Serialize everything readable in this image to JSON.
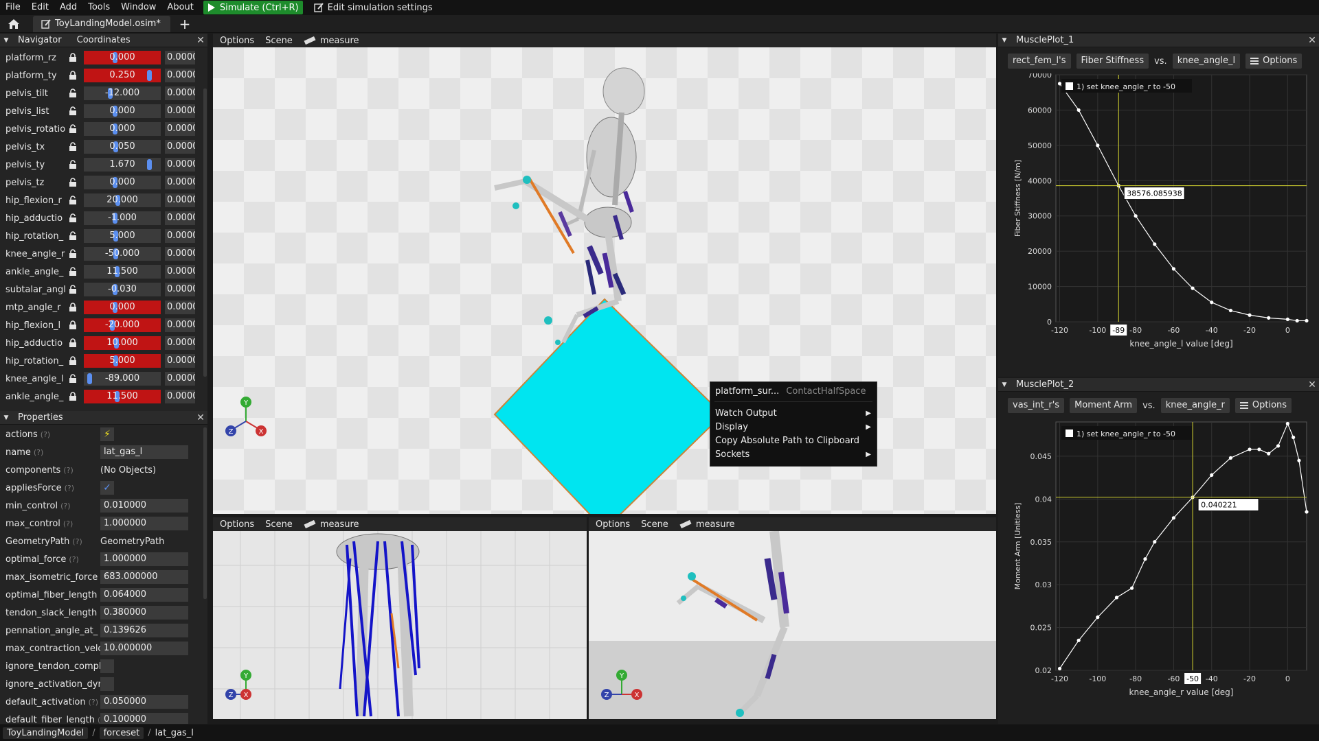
{
  "menu": {
    "items": [
      "File",
      "Edit",
      "Add",
      "Tools",
      "Window",
      "About"
    ],
    "simulate_label": "Simulate (Ctrl+R)",
    "edit_settings_label": "Edit simulation settings"
  },
  "tabs": {
    "document": "ToyLandingModel.osim*"
  },
  "navigator": {
    "title": "Navigator",
    "coords_tab": "Coordinates",
    "rows": [
      {
        "name": "platform_rz",
        "value": "0.000",
        "speed": "0.0000",
        "locked": true,
        "knob": 0.4
      },
      {
        "name": "platform_ty",
        "value": "0.250",
        "speed": "0.0000",
        "locked": true,
        "knob": 0.88
      },
      {
        "name": "pelvis_tilt",
        "value": "-12.000",
        "speed": "0.0000",
        "locked": false,
        "knob": 0.33
      },
      {
        "name": "pelvis_list",
        "value": "0.000",
        "speed": "0.0000",
        "locked": false,
        "knob": 0.4
      },
      {
        "name": "pelvis_rotatio",
        "value": "0.000",
        "speed": "0.0000",
        "locked": false,
        "knob": 0.4
      },
      {
        "name": "pelvis_tx",
        "value": "0.050",
        "speed": "0.0000",
        "locked": false,
        "knob": 0.41
      },
      {
        "name": "pelvis_ty",
        "value": "1.670",
        "speed": "0.0000",
        "locked": false,
        "knob": 0.88
      },
      {
        "name": "pelvis_tz",
        "value": "0.000",
        "speed": "0.0000",
        "locked": false,
        "knob": 0.4
      },
      {
        "name": "hip_flexion_r",
        "value": "20.000",
        "speed": "0.0000",
        "locked": false,
        "knob": 0.44
      },
      {
        "name": "hip_adductio",
        "value": "-1.000",
        "speed": "0.0000",
        "locked": false,
        "knob": 0.4
      },
      {
        "name": "hip_rotation_",
        "value": "5.000",
        "speed": "0.0000",
        "locked": false,
        "knob": 0.41
      },
      {
        "name": "knee_angle_r",
        "value": "-50.000",
        "speed": "0.0000",
        "locked": false,
        "knob": 0.41
      },
      {
        "name": "ankle_angle_",
        "value": "11.500",
        "speed": "0.0000",
        "locked": false,
        "knob": 0.43
      },
      {
        "name": "subtalar_angl",
        "value": "-0.030",
        "speed": "0.0000",
        "locked": false,
        "knob": 0.4
      },
      {
        "name": "mtp_angle_r",
        "value": "0.000",
        "speed": "0.0000",
        "locked": true,
        "knob": 0.4
      },
      {
        "name": "hip_flexion_l",
        "value": "-20.000",
        "speed": "0.0000",
        "locked": true,
        "knob": 0.36
      },
      {
        "name": "hip_adductio",
        "value": "10.000",
        "speed": "0.0000",
        "locked": true,
        "knob": 0.42
      },
      {
        "name": "hip_rotation_",
        "value": "5.000",
        "speed": "0.0000",
        "locked": true,
        "knob": 0.41
      },
      {
        "name": "knee_angle_l",
        "value": "-89.000",
        "speed": "0.0000",
        "locked": false,
        "knob": 0.05
      },
      {
        "name": "ankle_angle_",
        "value": "11.500",
        "speed": "0.0000",
        "locked": true,
        "knob": 0.43
      }
    ]
  },
  "properties": {
    "title": "Properties",
    "help": "(?)",
    "rows": [
      {
        "name": "actions",
        "kind": "action",
        "value": ""
      },
      {
        "name": "name",
        "kind": "field",
        "value": "lat_gas_l"
      },
      {
        "name": "components",
        "kind": "text",
        "value": "(No Objects)"
      },
      {
        "name": "appliesForce",
        "kind": "check",
        "value": "✓"
      },
      {
        "name": "min_control",
        "kind": "field",
        "value": "0.010000"
      },
      {
        "name": "max_control",
        "kind": "field",
        "value": "1.000000"
      },
      {
        "name": "GeometryPath",
        "kind": "text",
        "value": "GeometryPath"
      },
      {
        "name": "optimal_force",
        "kind": "field",
        "value": "1.000000"
      },
      {
        "name": "max_isometric_force",
        "kind": "field",
        "value": "683.000000"
      },
      {
        "name": "optimal_fiber_length",
        "kind": "field",
        "value": "0.064000"
      },
      {
        "name": "tendon_slack_length",
        "kind": "field",
        "value": "0.380000"
      },
      {
        "name": "pennation_angle_at_",
        "kind": "field",
        "value": "0.139626"
      },
      {
        "name": "max_contraction_velc",
        "kind": "field",
        "value": "10.000000"
      },
      {
        "name": "ignore_tendon_compl",
        "kind": "check",
        "value": ""
      },
      {
        "name": "ignore_activation_dyr",
        "kind": "check",
        "value": ""
      },
      {
        "name": "default_activation",
        "kind": "field",
        "value": "0.050000"
      },
      {
        "name": "default_fiber_length",
        "kind": "field",
        "value": "0.100000"
      }
    ]
  },
  "viewport": {
    "options": "Options",
    "scene": "Scene",
    "measure": "measure",
    "axis_x": "X",
    "axis_y": "Y",
    "axis_z": "Z"
  },
  "context_menu": {
    "title": "platform_sur...",
    "subtitle": "ContactHalfSpace",
    "items": [
      {
        "label": "Watch Output",
        "submenu": true
      },
      {
        "label": "Display",
        "submenu": true
      },
      {
        "label": "Copy Absolute Path to Clipboard",
        "submenu": false
      },
      {
        "label": "Sockets",
        "submenu": true
      }
    ]
  },
  "plot1": {
    "title": "MusclePlot_1",
    "muscle": "rect_fem_l",
    "apostrophe": "'s",
    "output": "Fiber Stiffness",
    "vs": "vs.",
    "coordinate": "knee_angle_l",
    "options": "Options",
    "legend": "1) set knee_angle_r to -50",
    "hover_value": "38576.085938",
    "marker_label": "-89"
  },
  "plot2": {
    "title": "MusclePlot_2",
    "muscle": "vas_int_r",
    "apostrophe": "'s",
    "output": "Moment Arm",
    "vs": "vs.",
    "coordinate": "knee_angle_r",
    "options": "Options",
    "legend": "1) set knee_angle_r to -50",
    "hover_value": "0.040221",
    "marker_label": "-50"
  },
  "chart_data": [
    {
      "type": "scatter",
      "title": "",
      "xlabel": "knee_angle_l value [deg]",
      "ylabel": "Fiber Stiffness [N/m]",
      "xlim": [
        -122,
        10
      ],
      "ylim": [
        0,
        70000
      ],
      "x_ticks": [
        -120,
        -100,
        -80,
        -60,
        -40,
        -20,
        0
      ],
      "y_ticks": [
        0,
        10000,
        20000,
        30000,
        40000,
        50000,
        60000,
        70000
      ],
      "grid": true,
      "series": [
        {
          "name": "1) set knee_angle_r to -50",
          "x": [
            -120,
            -110,
            -100,
            -89,
            -80,
            -70,
            -60,
            -50,
            -40,
            -30,
            -20,
            -10,
            0,
            5,
            10
          ],
          "y": [
            67500,
            60000,
            50000,
            38576,
            30000,
            22000,
            15000,
            9500,
            5500,
            3200,
            1900,
            1100,
            700,
            300,
            300
          ]
        }
      ],
      "cursor_x": -89,
      "cursor_y": 38576.085938
    },
    {
      "type": "scatter",
      "title": "",
      "xlabel": "knee_angle_r value [deg]",
      "ylabel": "Moment Arm [Unitless]",
      "xlim": [
        -122,
        10
      ],
      "ylim": [
        0.02,
        0.049
      ],
      "x_ticks": [
        -120,
        -100,
        -80,
        -60,
        -40,
        -20,
        0
      ],
      "y_ticks": [
        0.02,
        0.025,
        0.03,
        0.035,
        0.04,
        0.045
      ],
      "grid": true,
      "series": [
        {
          "name": "1) set knee_angle_r to -50",
          "x": [
            -120,
            -110,
            -100,
            -90,
            -82,
            -75,
            -70,
            -60,
            -50,
            -40,
            -30,
            -20,
            -15,
            -10,
            -5,
            0,
            3,
            6,
            10
          ],
          "y": [
            0.0202,
            0.0235,
            0.0262,
            0.0285,
            0.0296,
            0.033,
            0.035,
            0.0378,
            0.0402,
            0.0428,
            0.0448,
            0.0458,
            0.0458,
            0.0453,
            0.0462,
            0.0488,
            0.0472,
            0.0445,
            0.0385
          ]
        }
      ],
      "cursor_x": -50,
      "cursor_y": 0.040221
    }
  ],
  "breadcrumb": {
    "items": [
      "ToyLandingModel",
      "forceset"
    ],
    "current": "lat_gas_l",
    "sep": "/"
  },
  "colors": {
    "accent": "#5b8ff0",
    "locked": "#c01414",
    "platform": "#00e5f0",
    "simulate": "#1e8c2c",
    "plot_line": "#d4d430"
  }
}
